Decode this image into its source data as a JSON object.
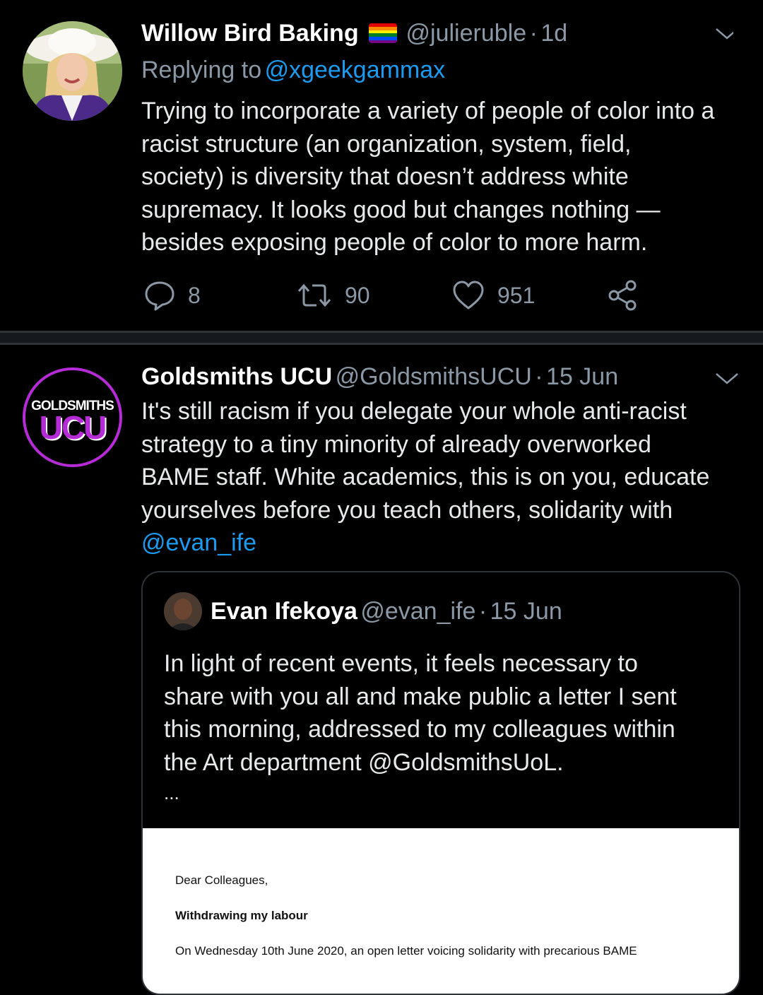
{
  "tweet1": {
    "display_name": "Willow Bird Baking",
    "handle": "@julieruble",
    "separator": "·",
    "time": "1d",
    "reply_prefix": "Replying to",
    "reply_to": "@xgeekgammax",
    "text_lines": [
      "Trying to incorporate a variety of people of color into a",
      "racist structure (an organization, system, field,",
      "society) is diversity that doesn’t address white",
      "supremacy. It looks good but changes nothing —",
      "besides exposing people of color to more harm."
    ],
    "actions": {
      "replies": "8",
      "retweets": "90",
      "likes": "951"
    }
  },
  "tweet2": {
    "display_name": "Goldsmiths UCU",
    "handle": "@GoldsmithsUCU",
    "separator": "·",
    "time": "15 Jun",
    "avatar_text_top": "GOLDSMITHS",
    "avatar_text_bottom": "UCU",
    "text_lines": [
      "It's still racism if you delegate your whole anti-racist",
      "strategy to a tiny minority of already overworked",
      "BAME staff. White academics, this is on you, educate",
      "yourselves before you teach others, solidarity with"
    ],
    "mention": "@evan_ife",
    "quote": {
      "display_name": "Evan Ifekoya",
      "handle": "@evan_ife",
      "separator": "·",
      "time": "15 Jun",
      "text_lines": [
        "In light of recent events, it feels necessary to",
        "share with you all and make public a letter I sent",
        "this morning, addressed to my colleagues within",
        "the Art department @GoldsmithsUoL."
      ],
      "ellipsis": "...",
      "letter": {
        "greeting": "Dear Colleagues,",
        "heading": "Withdrawing my labour",
        "first_line": "On Wednesday 10th June 2020, an open letter voicing solidarity with precarious BAME"
      }
    }
  },
  "colors": {
    "background": "#000000",
    "link": "#1d9bf0",
    "muted": "#8b98a5",
    "ucu_purple": "#b52bd6"
  }
}
